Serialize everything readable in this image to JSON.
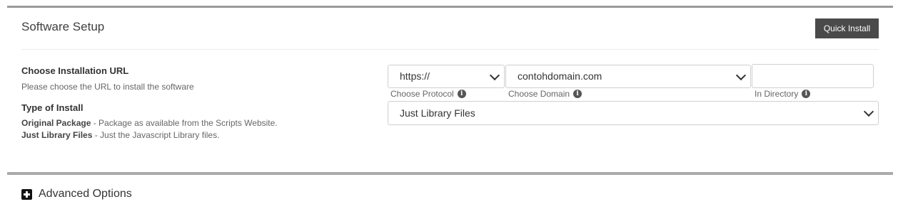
{
  "section": {
    "title": "Software Setup",
    "quick_install_label": "Quick Install"
  },
  "install_url": {
    "label": "Choose Installation URL",
    "help": "Please choose the URL to install the software",
    "protocol": {
      "value": "https://",
      "caption": "Choose Protocol",
      "icon": "info-icon"
    },
    "domain": {
      "value": "contohdomain.com",
      "caption": "Choose Domain",
      "icon": "info-icon"
    },
    "directory": {
      "value": "",
      "caption": "In Directory",
      "icon": "info-icon"
    }
  },
  "install_type": {
    "label": "Type of Install",
    "selected": "Just Library Files",
    "descriptions": [
      {
        "name": "Original Package",
        "text": " - Package as available from the Scripts Website."
      },
      {
        "name": "Just Library Files",
        "text": " - Just the Javascript Library files."
      }
    ]
  },
  "advanced": {
    "label": "Advanced Options",
    "icon": "plus-square-icon"
  }
}
